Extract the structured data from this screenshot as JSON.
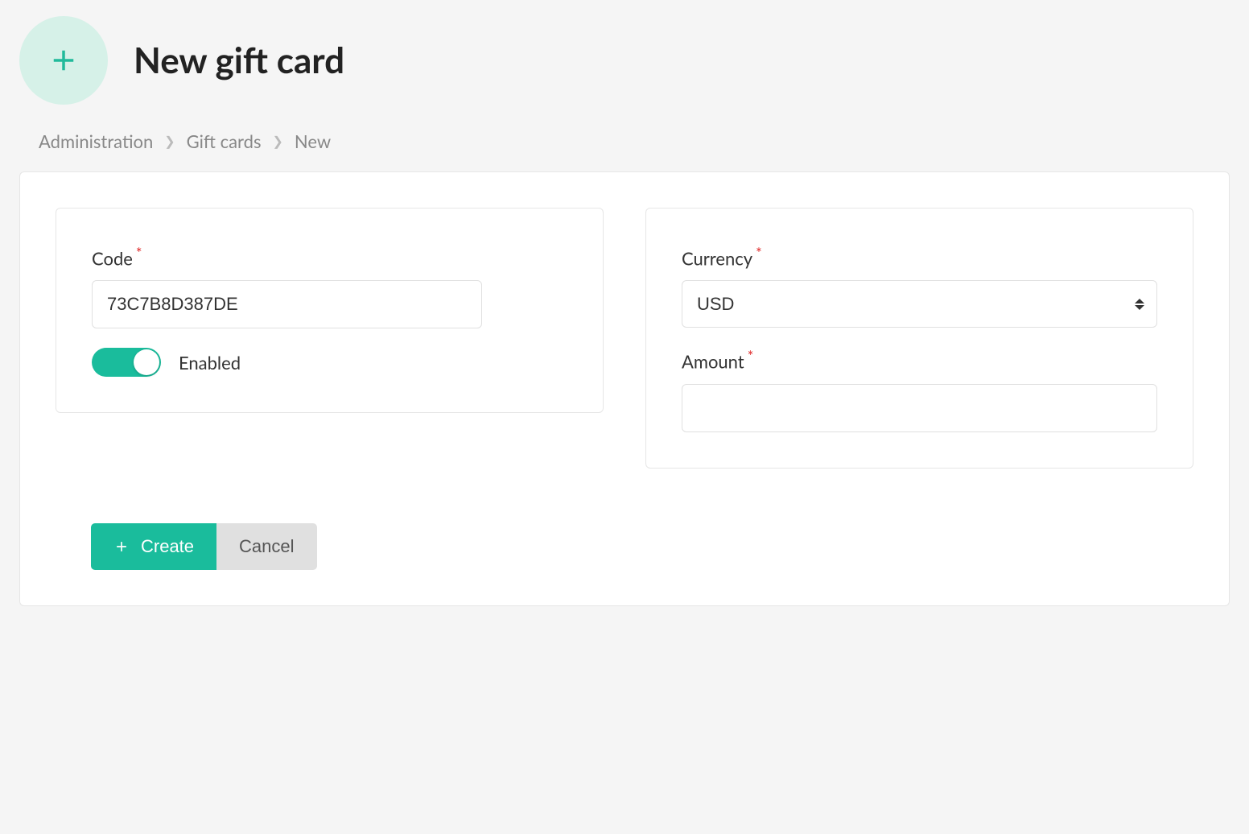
{
  "header": {
    "title": "New gift card"
  },
  "breadcrumb": {
    "items": [
      "Administration",
      "Gift cards",
      "New"
    ]
  },
  "form": {
    "code": {
      "label": "Code",
      "value": "73C7B8D387DE",
      "required": true
    },
    "enabled": {
      "label": "Enabled",
      "value": true
    },
    "currency": {
      "label": "Currency",
      "value": "USD",
      "required": true
    },
    "amount": {
      "label": "Amount",
      "value": "",
      "required": true
    }
  },
  "actions": {
    "create": "Create",
    "cancel": "Cancel"
  }
}
